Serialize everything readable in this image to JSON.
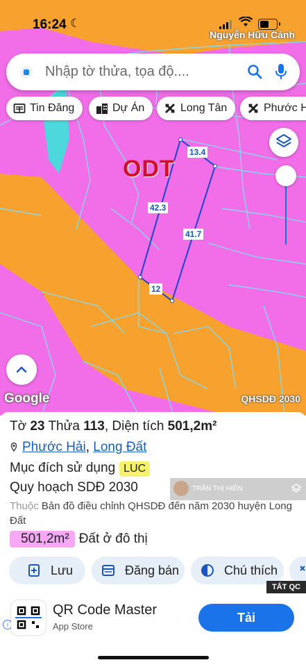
{
  "status_bar": {
    "time": "16:24",
    "location": "Nguyễn Hữu Cảnh"
  },
  "search": {
    "placeholder": "Nhập tờ thửa, tọa độ...."
  },
  "chips": [
    {
      "label": "Tin Đăng",
      "icon": "newspaper-icon"
    },
    {
      "label": "Dự Án",
      "icon": "city-icon"
    },
    {
      "label": "Long Tân",
      "icon": "cross-icon"
    },
    {
      "label": "Phước H",
      "icon": "cross-icon"
    }
  ],
  "map": {
    "zone_label": "ODT",
    "edge_lengths": {
      "top": "13.4",
      "left": "42.3",
      "right": "41.7",
      "bottom": "12"
    },
    "attribution": "Google",
    "layer_name": "QHSDĐ 2030",
    "colors": {
      "residential": "#f26ee9",
      "agricultural": "#f7a22e",
      "boundary": "#86d8e8",
      "road": "#4cd8dc",
      "parcel_outline": "#1847c8"
    }
  },
  "parcel": {
    "sheet_label": "Tờ",
    "sheet": "23",
    "plot_label": "Thửa",
    "plot": "113",
    "area_label": "Diện tích",
    "area": "501,2m²",
    "ward": "Phước Hải",
    "separator": ",",
    "district": "Long Đất",
    "purpose_label": "Mục đích sử dụng",
    "purpose_code": "LUC",
    "plan_label": "Quy hoạch SDĐ 2030",
    "belongs_prefix": "Thuộc",
    "belongs_text": "Bản đồ điều chỉnh QHSDĐ đến năm 2030 huyện Long Đất",
    "zone_area": "501,2m²",
    "zone_name": "Đất ở đô thị"
  },
  "overlay": {
    "name": "TRẦN THỊ HIÊN"
  },
  "actions": [
    {
      "label": "Lưu",
      "icon": "save-icon"
    },
    {
      "label": "Đăng bán",
      "icon": "listing-icon"
    },
    {
      "label": "Chú thích",
      "icon": "legend-icon"
    }
  ],
  "ad": {
    "close_label": "TẮT QC",
    "title": "QR Code Master",
    "subtitle": "App Store",
    "cta": "Tải"
  }
}
